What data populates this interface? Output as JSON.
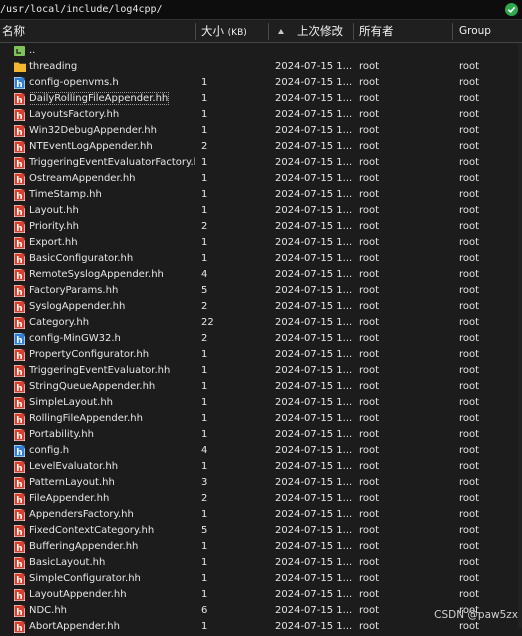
{
  "path": "/usr/local/include/log4cpp/",
  "columns": {
    "name": "名称",
    "size": "大小",
    "size_unit": "(KB)",
    "modified": "上次修改",
    "owner": "所有者",
    "group": "Group"
  },
  "sort": {
    "column": "modified",
    "direction": "ascending"
  },
  "files": [
    {
      "name": "..",
      "type": "parent",
      "size": "",
      "modified": "",
      "owner": "",
      "group": ""
    },
    {
      "name": "threading",
      "type": "folder",
      "size": "",
      "modified": "2024-07-15 1...",
      "owner": "root",
      "group": "root"
    },
    {
      "name": "config-openvms.h",
      "type": "h",
      "size": "1",
      "modified": "2024-07-15 1...",
      "owner": "root",
      "group": "root"
    },
    {
      "name": "DailyRollingFileAppender.hh",
      "type": "hh",
      "size": "1",
      "modified": "2024-07-15 1...",
      "owner": "root",
      "group": "root",
      "selected": true
    },
    {
      "name": "LayoutsFactory.hh",
      "type": "hh",
      "size": "1",
      "modified": "2024-07-15 1...",
      "owner": "root",
      "group": "root"
    },
    {
      "name": "Win32DebugAppender.hh",
      "type": "hh",
      "size": "1",
      "modified": "2024-07-15 1...",
      "owner": "root",
      "group": "root"
    },
    {
      "name": "NTEventLogAppender.hh",
      "type": "hh",
      "size": "2",
      "modified": "2024-07-15 1...",
      "owner": "root",
      "group": "root"
    },
    {
      "name": "TriggeringEventEvaluatorFactory.hh",
      "type": "hh",
      "size": "1",
      "modified": "2024-07-15 1...",
      "owner": "root",
      "group": "root"
    },
    {
      "name": "OstreamAppender.hh",
      "type": "hh",
      "size": "1",
      "modified": "2024-07-15 1...",
      "owner": "root",
      "group": "root"
    },
    {
      "name": "TimeStamp.hh",
      "type": "hh",
      "size": "1",
      "modified": "2024-07-15 1...",
      "owner": "root",
      "group": "root"
    },
    {
      "name": "Layout.hh",
      "type": "hh",
      "size": "1",
      "modified": "2024-07-15 1...",
      "owner": "root",
      "group": "root"
    },
    {
      "name": "Priority.hh",
      "type": "hh",
      "size": "2",
      "modified": "2024-07-15 1...",
      "owner": "root",
      "group": "root"
    },
    {
      "name": "Export.hh",
      "type": "hh",
      "size": "1",
      "modified": "2024-07-15 1...",
      "owner": "root",
      "group": "root"
    },
    {
      "name": "BasicConfigurator.hh",
      "type": "hh",
      "size": "1",
      "modified": "2024-07-15 1...",
      "owner": "root",
      "group": "root"
    },
    {
      "name": "RemoteSyslogAppender.hh",
      "type": "hh",
      "size": "4",
      "modified": "2024-07-15 1...",
      "owner": "root",
      "group": "root"
    },
    {
      "name": "FactoryParams.hh",
      "type": "hh",
      "size": "5",
      "modified": "2024-07-15 1...",
      "owner": "root",
      "group": "root"
    },
    {
      "name": "SyslogAppender.hh",
      "type": "hh",
      "size": "2",
      "modified": "2024-07-15 1...",
      "owner": "root",
      "group": "root"
    },
    {
      "name": "Category.hh",
      "type": "hh",
      "size": "22",
      "modified": "2024-07-15 1...",
      "owner": "root",
      "group": "root"
    },
    {
      "name": "config-MinGW32.h",
      "type": "h",
      "size": "2",
      "modified": "2024-07-15 1...",
      "owner": "root",
      "group": "root"
    },
    {
      "name": "PropertyConfigurator.hh",
      "type": "hh",
      "size": "1",
      "modified": "2024-07-15 1...",
      "owner": "root",
      "group": "root"
    },
    {
      "name": "TriggeringEventEvaluator.hh",
      "type": "hh",
      "size": "1",
      "modified": "2024-07-15 1...",
      "owner": "root",
      "group": "root"
    },
    {
      "name": "StringQueueAppender.hh",
      "type": "hh",
      "size": "1",
      "modified": "2024-07-15 1...",
      "owner": "root",
      "group": "root"
    },
    {
      "name": "SimpleLayout.hh",
      "type": "hh",
      "size": "1",
      "modified": "2024-07-15 1...",
      "owner": "root",
      "group": "root"
    },
    {
      "name": "RollingFileAppender.hh",
      "type": "hh",
      "size": "1",
      "modified": "2024-07-15 1...",
      "owner": "root",
      "group": "root"
    },
    {
      "name": "Portability.hh",
      "type": "hh",
      "size": "1",
      "modified": "2024-07-15 1...",
      "owner": "root",
      "group": "root"
    },
    {
      "name": "config.h",
      "type": "h",
      "size": "4",
      "modified": "2024-07-15 1...",
      "owner": "root",
      "group": "root"
    },
    {
      "name": "LevelEvaluator.hh",
      "type": "hh",
      "size": "1",
      "modified": "2024-07-15 1...",
      "owner": "root",
      "group": "root"
    },
    {
      "name": "PatternLayout.hh",
      "type": "hh",
      "size": "3",
      "modified": "2024-07-15 1...",
      "owner": "root",
      "group": "root"
    },
    {
      "name": "FileAppender.hh",
      "type": "hh",
      "size": "2",
      "modified": "2024-07-15 1...",
      "owner": "root",
      "group": "root"
    },
    {
      "name": "AppendersFactory.hh",
      "type": "hh",
      "size": "1",
      "modified": "2024-07-15 1...",
      "owner": "root",
      "group": "root"
    },
    {
      "name": "FixedContextCategory.hh",
      "type": "hh",
      "size": "5",
      "modified": "2024-07-15 1...",
      "owner": "root",
      "group": "root"
    },
    {
      "name": "BufferingAppender.hh",
      "type": "hh",
      "size": "1",
      "modified": "2024-07-15 1...",
      "owner": "root",
      "group": "root"
    },
    {
      "name": "BasicLayout.hh",
      "type": "hh",
      "size": "1",
      "modified": "2024-07-15 1...",
      "owner": "root",
      "group": "root"
    },
    {
      "name": "SimpleConfigurator.hh",
      "type": "hh",
      "size": "1",
      "modified": "2024-07-15 1...",
      "owner": "root",
      "group": "root"
    },
    {
      "name": "LayoutAppender.hh",
      "type": "hh",
      "size": "1",
      "modified": "2024-07-15 1...",
      "owner": "root",
      "group": "root"
    },
    {
      "name": "NDC.hh",
      "type": "hh",
      "size": "6",
      "modified": "2024-07-15 1...",
      "owner": "root",
      "group": "root"
    },
    {
      "name": "AbortAppender.hh",
      "type": "hh",
      "size": "1",
      "modified": "2024-07-15 1...",
      "owner": "root",
      "group": "root"
    }
  ],
  "watermark": "CSDN @paw5zx",
  "colors": {
    "folder": "#f2b632",
    "parent_icon": "#7fc35a",
    "hh_icon": "#d8412f",
    "h_icon": "#2f7fd6",
    "ok": "#2fa84f"
  }
}
